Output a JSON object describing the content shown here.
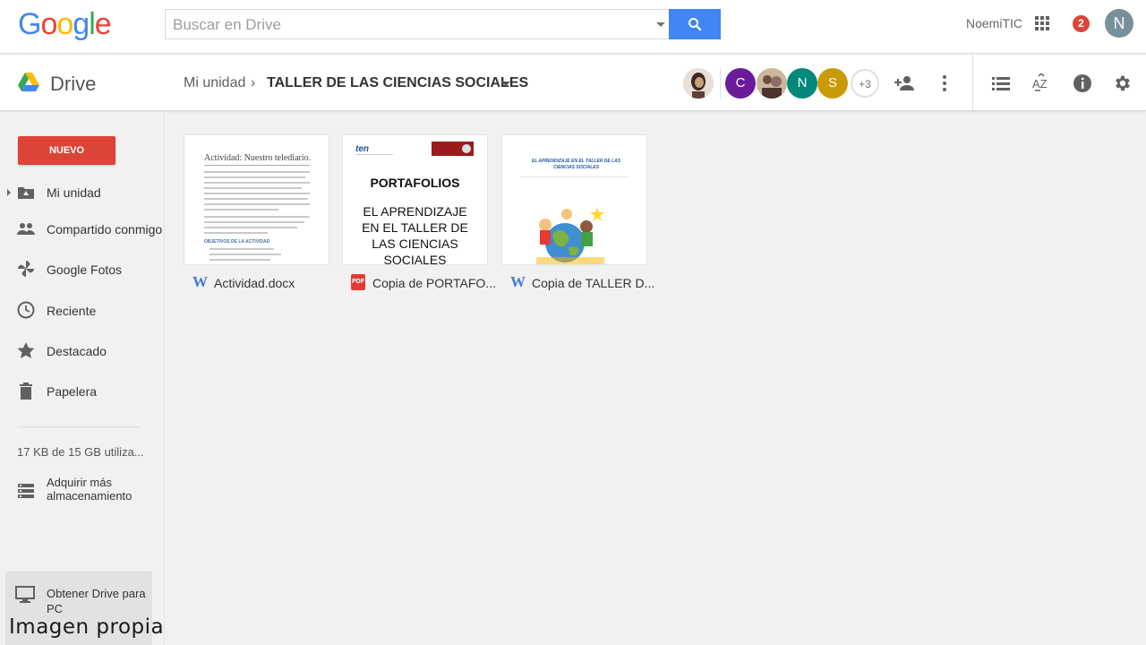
{
  "header": {
    "logo_letters": [
      {
        "ch": "G",
        "color": "#4285f4"
      },
      {
        "ch": "o",
        "color": "#ea4335"
      },
      {
        "ch": "o",
        "color": "#fbbc05"
      },
      {
        "ch": "g",
        "color": "#4285f4"
      },
      {
        "ch": "l",
        "color": "#34a853"
      },
      {
        "ch": "e",
        "color": "#ea4335"
      }
    ],
    "search_placeholder": "Buscar en Drive",
    "username": "NoemiTIC",
    "notification_count": "2",
    "account_initial": "N"
  },
  "subheader": {
    "app_name": "Drive",
    "breadcrumb_root": "Mi unidad",
    "breadcrumb_separator": "›",
    "breadcrumb_current": "TALLER DE LAS CIENCIAS SOCIALES",
    "collaborators": [
      {
        "initial": "",
        "color": "#5d4037",
        "type": "photo"
      },
      {
        "initial": "C",
        "color": "#6a1b9a",
        "type": "letter"
      },
      {
        "initial": "",
        "color": "#8d6e63",
        "type": "photo"
      },
      {
        "initial": "N",
        "color": "#00897b",
        "type": "letter"
      },
      {
        "initial": "S",
        "color": "#c99a06",
        "type": "letter"
      }
    ],
    "more_collaborators": "+3"
  },
  "sidebar": {
    "new_button": "NUEVO",
    "items": [
      {
        "label": "Mi unidad",
        "icon": "my-drive-icon"
      },
      {
        "label": "Compartido conmigo",
        "icon": "shared-people-icon"
      },
      {
        "label": "Google Fotos",
        "icon": "photos-pinwheel-icon"
      },
      {
        "label": "Reciente",
        "icon": "clock-icon"
      },
      {
        "label": "Destacado",
        "icon": "star-icon"
      },
      {
        "label": "Papelera",
        "icon": "trash-icon"
      }
    ],
    "storage_text": "17 KB de 15 GB utiliza...",
    "buy_storage": "Adquirir más almacenamiento",
    "get_drive": "Obtener Drive para PC"
  },
  "files": [
    {
      "name": "Actividad.docx",
      "type": "word",
      "icon_text": "W",
      "thumb_title": "Actividad: Nuestro telediario.",
      "thumb_heading": "OBJETIVOS DE LA ACTIVIDAD"
    },
    {
      "name": "Copia de PORTAFO...",
      "type": "pdf",
      "icon_text": "PDF",
      "thumb_logo": "ten",
      "thumb_title": "PORTAFOLIOS",
      "thumb_sub": [
        "EL APRENDIZAJE",
        "EN EL TALLER DE",
        "LAS CIENCIAS",
        "SOCIALES"
      ]
    },
    {
      "name": "Copia de TALLER D...",
      "type": "word",
      "icon_text": "W",
      "thumb_title": "EL APRENDIZAJE EN EL TALLER DE LAS CIENCIAS SOCIALES"
    }
  ],
  "watermark": "Imagen propia",
  "colors": {
    "accent_blue": "#4285f4",
    "new_button_red": "#db4437",
    "background": "#f1f1f1"
  }
}
